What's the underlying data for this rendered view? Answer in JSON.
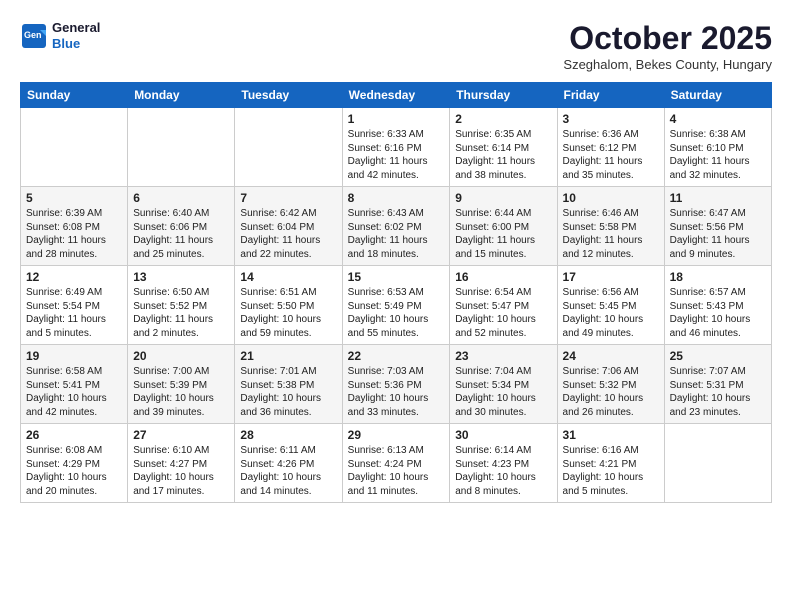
{
  "header": {
    "logo": {
      "general": "General",
      "blue": "Blue"
    },
    "title": "October 2025",
    "location": "Szeghalom, Bekes County, Hungary"
  },
  "weekdays": [
    "Sunday",
    "Monday",
    "Tuesday",
    "Wednesday",
    "Thursday",
    "Friday",
    "Saturday"
  ],
  "weeks": [
    [
      {
        "day": "",
        "sunrise": "",
        "sunset": "",
        "daylight": ""
      },
      {
        "day": "",
        "sunrise": "",
        "sunset": "",
        "daylight": ""
      },
      {
        "day": "",
        "sunrise": "",
        "sunset": "",
        "daylight": ""
      },
      {
        "day": "1",
        "sunrise": "Sunrise: 6:33 AM",
        "sunset": "Sunset: 6:16 PM",
        "daylight": "Daylight: 11 hours and 42 minutes."
      },
      {
        "day": "2",
        "sunrise": "Sunrise: 6:35 AM",
        "sunset": "Sunset: 6:14 PM",
        "daylight": "Daylight: 11 hours and 38 minutes."
      },
      {
        "day": "3",
        "sunrise": "Sunrise: 6:36 AM",
        "sunset": "Sunset: 6:12 PM",
        "daylight": "Daylight: 11 hours and 35 minutes."
      },
      {
        "day": "4",
        "sunrise": "Sunrise: 6:38 AM",
        "sunset": "Sunset: 6:10 PM",
        "daylight": "Daylight: 11 hours and 32 minutes."
      }
    ],
    [
      {
        "day": "5",
        "sunrise": "Sunrise: 6:39 AM",
        "sunset": "Sunset: 6:08 PM",
        "daylight": "Daylight: 11 hours and 28 minutes."
      },
      {
        "day": "6",
        "sunrise": "Sunrise: 6:40 AM",
        "sunset": "Sunset: 6:06 PM",
        "daylight": "Daylight: 11 hours and 25 minutes."
      },
      {
        "day": "7",
        "sunrise": "Sunrise: 6:42 AM",
        "sunset": "Sunset: 6:04 PM",
        "daylight": "Daylight: 11 hours and 22 minutes."
      },
      {
        "day": "8",
        "sunrise": "Sunrise: 6:43 AM",
        "sunset": "Sunset: 6:02 PM",
        "daylight": "Daylight: 11 hours and 18 minutes."
      },
      {
        "day": "9",
        "sunrise": "Sunrise: 6:44 AM",
        "sunset": "Sunset: 6:00 PM",
        "daylight": "Daylight: 11 hours and 15 minutes."
      },
      {
        "day": "10",
        "sunrise": "Sunrise: 6:46 AM",
        "sunset": "Sunset: 5:58 PM",
        "daylight": "Daylight: 11 hours and 12 minutes."
      },
      {
        "day": "11",
        "sunrise": "Sunrise: 6:47 AM",
        "sunset": "Sunset: 5:56 PM",
        "daylight": "Daylight: 11 hours and 9 minutes."
      }
    ],
    [
      {
        "day": "12",
        "sunrise": "Sunrise: 6:49 AM",
        "sunset": "Sunset: 5:54 PM",
        "daylight": "Daylight: 11 hours and 5 minutes."
      },
      {
        "day": "13",
        "sunrise": "Sunrise: 6:50 AM",
        "sunset": "Sunset: 5:52 PM",
        "daylight": "Daylight: 11 hours and 2 minutes."
      },
      {
        "day": "14",
        "sunrise": "Sunrise: 6:51 AM",
        "sunset": "Sunset: 5:50 PM",
        "daylight": "Daylight: 10 hours and 59 minutes."
      },
      {
        "day": "15",
        "sunrise": "Sunrise: 6:53 AM",
        "sunset": "Sunset: 5:49 PM",
        "daylight": "Daylight: 10 hours and 55 minutes."
      },
      {
        "day": "16",
        "sunrise": "Sunrise: 6:54 AM",
        "sunset": "Sunset: 5:47 PM",
        "daylight": "Daylight: 10 hours and 52 minutes."
      },
      {
        "day": "17",
        "sunrise": "Sunrise: 6:56 AM",
        "sunset": "Sunset: 5:45 PM",
        "daylight": "Daylight: 10 hours and 49 minutes."
      },
      {
        "day": "18",
        "sunrise": "Sunrise: 6:57 AM",
        "sunset": "Sunset: 5:43 PM",
        "daylight": "Daylight: 10 hours and 46 minutes."
      }
    ],
    [
      {
        "day": "19",
        "sunrise": "Sunrise: 6:58 AM",
        "sunset": "Sunset: 5:41 PM",
        "daylight": "Daylight: 10 hours and 42 minutes."
      },
      {
        "day": "20",
        "sunrise": "Sunrise: 7:00 AM",
        "sunset": "Sunset: 5:39 PM",
        "daylight": "Daylight: 10 hours and 39 minutes."
      },
      {
        "day": "21",
        "sunrise": "Sunrise: 7:01 AM",
        "sunset": "Sunset: 5:38 PM",
        "daylight": "Daylight: 10 hours and 36 minutes."
      },
      {
        "day": "22",
        "sunrise": "Sunrise: 7:03 AM",
        "sunset": "Sunset: 5:36 PM",
        "daylight": "Daylight: 10 hours and 33 minutes."
      },
      {
        "day": "23",
        "sunrise": "Sunrise: 7:04 AM",
        "sunset": "Sunset: 5:34 PM",
        "daylight": "Daylight: 10 hours and 30 minutes."
      },
      {
        "day": "24",
        "sunrise": "Sunrise: 7:06 AM",
        "sunset": "Sunset: 5:32 PM",
        "daylight": "Daylight: 10 hours and 26 minutes."
      },
      {
        "day": "25",
        "sunrise": "Sunrise: 7:07 AM",
        "sunset": "Sunset: 5:31 PM",
        "daylight": "Daylight: 10 hours and 23 minutes."
      }
    ],
    [
      {
        "day": "26",
        "sunrise": "Sunrise: 6:08 AM",
        "sunset": "Sunset: 4:29 PM",
        "daylight": "Daylight: 10 hours and 20 minutes."
      },
      {
        "day": "27",
        "sunrise": "Sunrise: 6:10 AM",
        "sunset": "Sunset: 4:27 PM",
        "daylight": "Daylight: 10 hours and 17 minutes."
      },
      {
        "day": "28",
        "sunrise": "Sunrise: 6:11 AM",
        "sunset": "Sunset: 4:26 PM",
        "daylight": "Daylight: 10 hours and 14 minutes."
      },
      {
        "day": "29",
        "sunrise": "Sunrise: 6:13 AM",
        "sunset": "Sunset: 4:24 PM",
        "daylight": "Daylight: 10 hours and 11 minutes."
      },
      {
        "day": "30",
        "sunrise": "Sunrise: 6:14 AM",
        "sunset": "Sunset: 4:23 PM",
        "daylight": "Daylight: 10 hours and 8 minutes."
      },
      {
        "day": "31",
        "sunrise": "Sunrise: 6:16 AM",
        "sunset": "Sunset: 4:21 PM",
        "daylight": "Daylight: 10 hours and 5 minutes."
      },
      {
        "day": "",
        "sunrise": "",
        "sunset": "",
        "daylight": ""
      }
    ]
  ]
}
